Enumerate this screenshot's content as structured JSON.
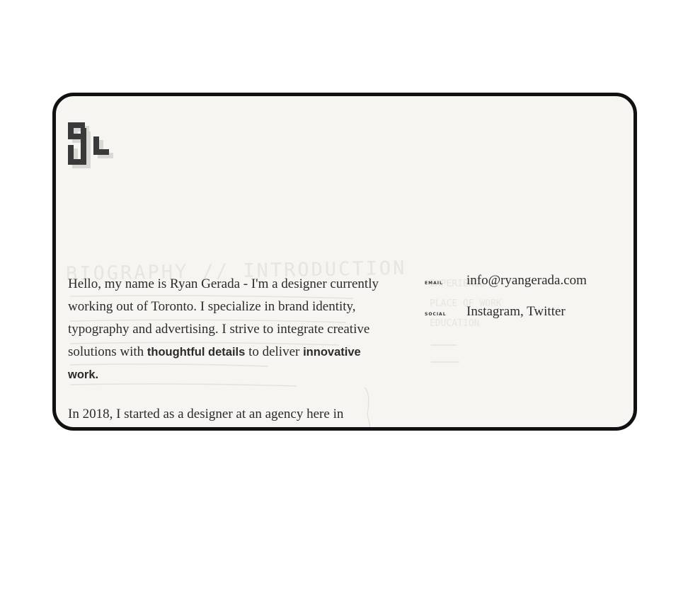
{
  "logo": {
    "icon": "monogram-logo-icon"
  },
  "background_sketch": {
    "heading": "BIOGRAPHY // INTRODUCTION",
    "notes": [
      "EXPERIENCE",
      "PLACE OF WORK",
      "EDUCATION"
    ]
  },
  "bio": {
    "intro": "Hello, my name is Ryan Gerada - I'm a designer currently working out of Toronto. I specialize in brand identity, typography and advertising. I strive to integrate creative solutions with",
    "emphasis_1": "thoughtful details",
    "connector": " to deliver ",
    "emphasis_2": "innovative work.",
    "paragraph_2": "In 2018, I started as a designer at an agency here in"
  },
  "contact": {
    "email_label": "EMAIL",
    "email": "info@ryangerada.com",
    "social_label": "SOCIAL",
    "social_instagram": "Instagram",
    "social_separator": ", ",
    "social_twitter": "Twitter"
  }
}
